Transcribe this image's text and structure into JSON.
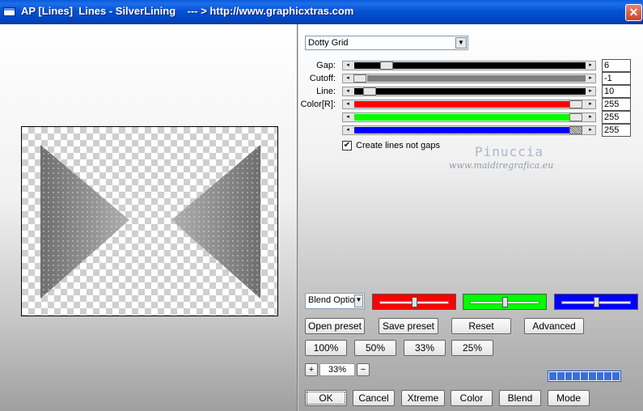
{
  "window": {
    "title": "AP [Lines]  Lines - SilverLining    --- > http://www.graphicxtras.com",
    "close_glyph": "✕"
  },
  "effect": {
    "selected": "Dotty Grid",
    "dropdown_arrow": "▼"
  },
  "parameters": {
    "gap": {
      "label": "Gap:",
      "value": "6",
      "level": 0.11
    },
    "cutoff": {
      "label": "Cutoff:",
      "value": "-1",
      "level": 0.0
    },
    "line": {
      "label": "Line:",
      "value": "10",
      "level": 0.04
    },
    "color_r": {
      "label": "Color[R]:",
      "value": "255",
      "level": 1.0,
      "color": "#ff0000"
    },
    "color_g": {
      "label": "",
      "value": "255",
      "level": 1.0,
      "color": "#00ff00"
    },
    "color_b": {
      "label": "",
      "value": "255",
      "level": 1.0,
      "color": "#0000ff"
    },
    "arrow_left": "◂",
    "arrow_right": "▸"
  },
  "checkbox": {
    "label": "Create lines not gaps",
    "checked": true,
    "mark": "✔"
  },
  "watermark": {
    "name": "Pinuccia",
    "site": "www.maidiregrafica.eu"
  },
  "blend": {
    "dropdown_value": "Blend Optio",
    "channels": [
      {
        "color": "#ff0000",
        "level": 0.5
      },
      {
        "color": "#00ff00",
        "level": 0.5
      },
      {
        "color": "#0000ff",
        "level": 0.5
      }
    ]
  },
  "buttons": {
    "open_preset": "Open preset",
    "save_preset": "Save preset",
    "reset": "Reset",
    "advanced": "Advanced",
    "zoom_100": "100%",
    "zoom_50": "50%",
    "zoom_33": "33%",
    "zoom_25": "25%",
    "ok": "OK",
    "cancel": "Cancel",
    "xtreme": "Xtreme",
    "color": "Color",
    "blend": "Blend",
    "mode": "Mode"
  },
  "zoom": {
    "plus": "+",
    "value": "33%",
    "minus": "−"
  },
  "progress": {
    "segments": 9
  },
  "colors": {
    "titlebar": "#0453d5",
    "progress": "#3a6fd8"
  }
}
